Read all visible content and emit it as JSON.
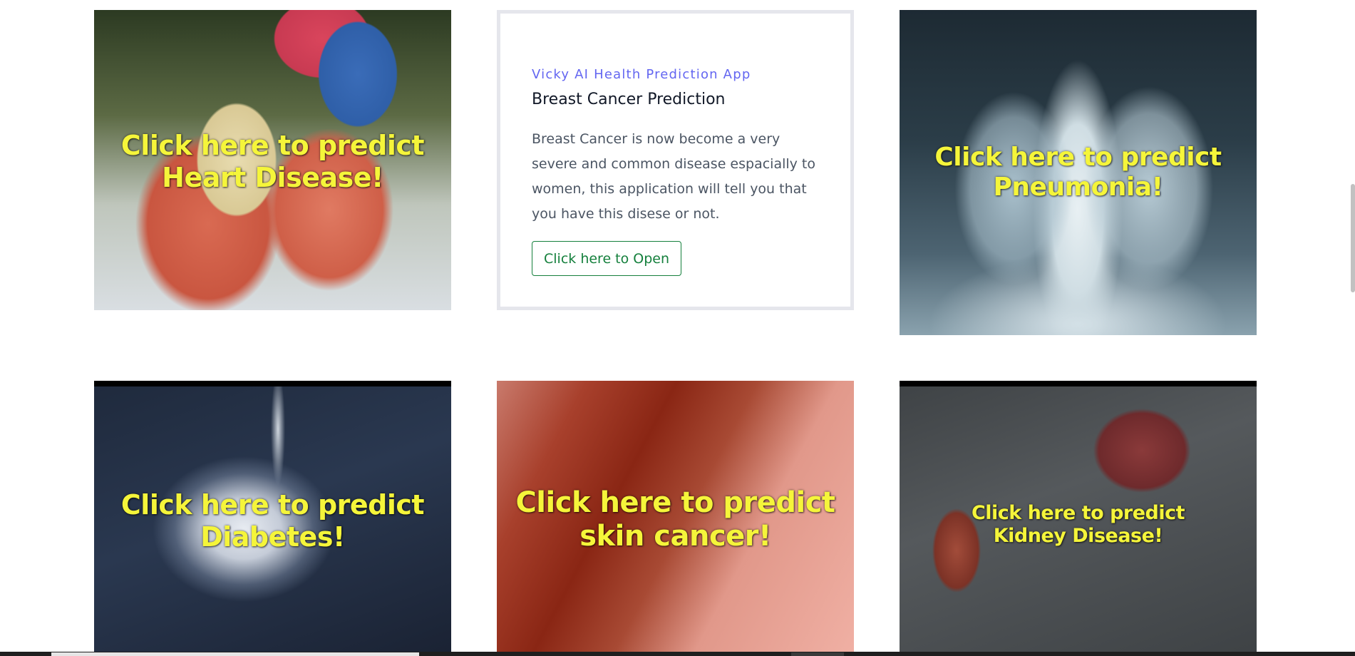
{
  "cards": {
    "heart": {
      "caption_line1": "Click here to predict",
      "caption_line2": "Heart Disease!"
    },
    "breast": {
      "brand": "Vicky AI Health Prediction App",
      "title": "Breast Cancer Prediction",
      "description": "Breast Cancer is now become a very severe and common disease espacially to women, this application will tell you that you have this disese or not.",
      "button_label": "Click here to Open"
    },
    "pneumonia": {
      "caption_line1": "Click here to predict",
      "caption_line2": "Pneumonia!"
    },
    "diabetes": {
      "caption_line1": "Click here to predict",
      "caption_line2": "Diabetes!"
    },
    "skin": {
      "caption_line1": "Click here to predict",
      "caption_line2": "skin cancer!"
    },
    "kidney": {
      "caption_line1": "Click here to predict",
      "caption_line2": "Kidney Disease!"
    }
  },
  "colors": {
    "caption": "#f5f53a",
    "brand": "#6366f1",
    "button": "#15803d"
  }
}
